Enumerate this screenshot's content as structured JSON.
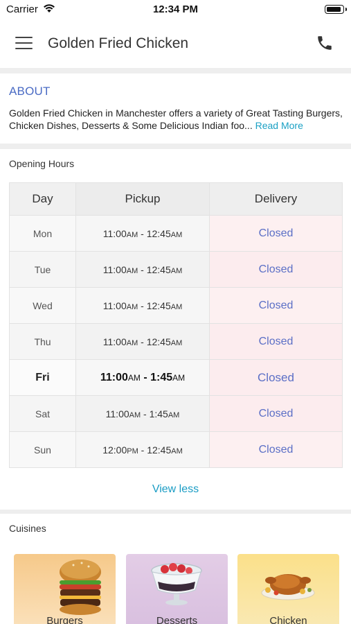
{
  "status_bar": {
    "carrier": "Carrier",
    "time": "12:34 PM"
  },
  "nav": {
    "title": "Golden Fried Chicken",
    "menu_icon": "hamburger-menu-icon",
    "call_icon": "phone-icon"
  },
  "about": {
    "title": "ABOUT",
    "text": "Golden Fried Chicken in Manchester offers a variety of Great Tasting Burgers, Chicken Dishes, Desserts & Some Delicious Indian foo...",
    "read_more": "Read More"
  },
  "opening_hours": {
    "title": "Opening Hours",
    "headers": [
      "Day",
      "Pickup",
      "Delivery"
    ],
    "rows": [
      {
        "day": "Mon",
        "open": "11:00",
        "open_ampm": "AM",
        "sep": " - ",
        "close": "12:45",
        "close_ampm": "AM",
        "delivery": "Closed"
      },
      {
        "day": "Tue",
        "open": "11:00",
        "open_ampm": "AM",
        "sep": " - ",
        "close": "12:45",
        "close_ampm": "AM",
        "delivery": "Closed"
      },
      {
        "day": "Wed",
        "open": "11:00",
        "open_ampm": "AM",
        "sep": " - ",
        "close": "12:45",
        "close_ampm": "AM",
        "delivery": "Closed"
      },
      {
        "day": "Thu",
        "open": "11:00",
        "open_ampm": "AM",
        "sep": " - ",
        "close": "12:45",
        "close_ampm": "AM",
        "delivery": "Closed"
      },
      {
        "day": "Fri",
        "open": "11:00",
        "open_ampm": "AM",
        "sep": " - ",
        "close": "1:45",
        "close_ampm": "AM",
        "delivery": "Closed"
      },
      {
        "day": "Sat",
        "open": "11:00",
        "open_ampm": "AM",
        "sep": " - ",
        "close": "1:45",
        "close_ampm": "AM",
        "delivery": "Closed"
      },
      {
        "day": "Sun",
        "open": "12:00",
        "open_ampm": "PM",
        "sep": " - ",
        "close": "12:45",
        "close_ampm": "AM",
        "delivery": "Closed"
      }
    ],
    "view_less": "View less"
  },
  "cuisines": {
    "title": "Cuisines",
    "items": [
      {
        "label": "Burgers",
        "icon": "burger-icon"
      },
      {
        "label": "Desserts",
        "icon": "dessert-bowl-icon"
      },
      {
        "label": "Chicken",
        "icon": "roast-chicken-icon"
      }
    ]
  },
  "colors": {
    "accent_link": "#1aa0c4",
    "about_title": "#4a6bc4",
    "closed_text": "#5b6fc6",
    "delivery_bg": "#fcecee"
  }
}
